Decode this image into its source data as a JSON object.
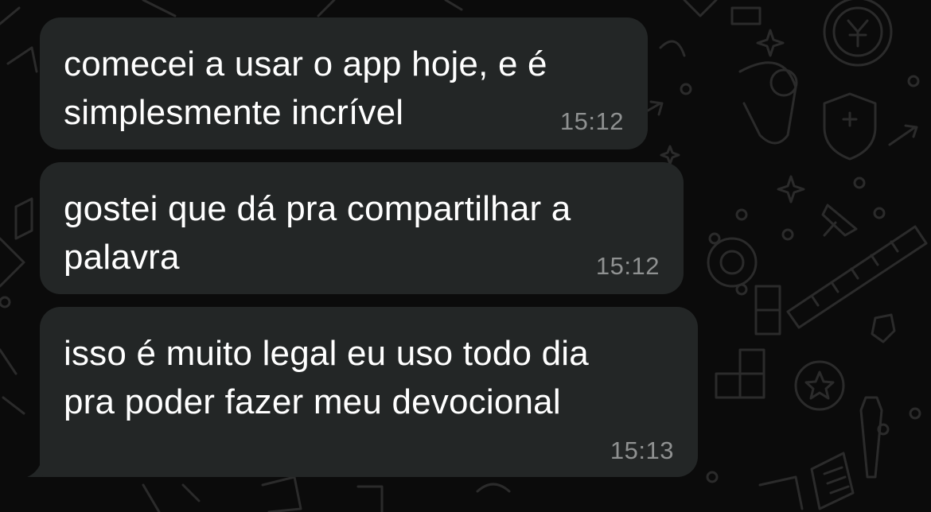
{
  "messages": [
    {
      "text": "comecei a usar o app hoje, e é\nsimplesmente incrível",
      "time": "15:12"
    },
    {
      "text": "gostei que dá pra compartilhar a\npalavra",
      "time": "15:12"
    },
    {
      "text": "isso é muito legal eu uso todo dia\npra poder fazer meu devocional",
      "time": "15:13"
    }
  ],
  "colors": {
    "background": "#0b0b0b",
    "bubble": "#232626",
    "text": "#ffffff",
    "timestamp": "#8f9191",
    "doodle": "#2a2a2a"
  },
  "icons": [
    "chat-wallpaper-doodle-pattern",
    "bubble-tail-icon"
  ]
}
